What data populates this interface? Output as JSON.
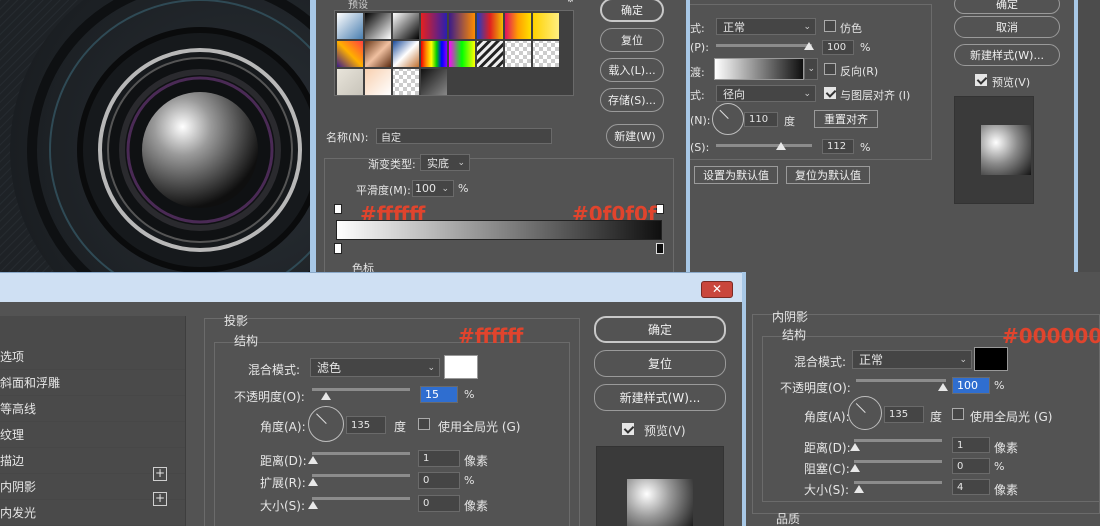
{
  "gradient_editor": {
    "title": "预设",
    "ok": "确定",
    "reset": "复位",
    "load": "载入(L)...",
    "save": "存储(S)...",
    "name_label": "名称(N):",
    "name_value": "自定",
    "new": "新建(W)",
    "type_label": "渐变类型:",
    "type_value": "实底",
    "smooth_label": "平滑度(M):",
    "smooth_value": "100",
    "smooth_unit": "%",
    "color_stops_label": "色标",
    "annotation_left": "#ffffff",
    "annotation_right": "#0f0f0f"
  },
  "gradient_overlay": {
    "mode_label": "式:",
    "mode_value": "正常",
    "dither": "仿色",
    "opacity_label": "(P):",
    "opacity_value": "100",
    "gradient_label": "渡:",
    "reverse": "反向(R)",
    "style_label": "式:",
    "style_value": "径向",
    "align": "与图层对齐 (I)",
    "angle_label": "(N):",
    "angle_value": "110",
    "angle_unit": "度",
    "reset_align": "重置对齐",
    "scale_label": "(S):",
    "scale_value": "112",
    "percent": "%",
    "set_default": "设置为默认值",
    "reset_default": "复位为默认值"
  },
  "top_right_dialog": {
    "ok": "确定",
    "cancel": "取消",
    "new_style": "新建样式(W)...",
    "preview": "预览(V)"
  },
  "drop_shadow": {
    "styles_list": [
      "选项",
      "斜面和浮雕",
      "等高线",
      "纹理",
      "描边",
      "内阴影",
      "内发光"
    ],
    "section_title": "投影",
    "structure": "结构",
    "blend_label": "混合模式:",
    "blend_value": "滤色",
    "opacity_label": "不透明度(O):",
    "opacity_value": "15",
    "percent": "%",
    "angle_label": "角度(A):",
    "angle_value": "135",
    "angle_unit": "度",
    "global_light": "使用全局光 (G)",
    "distance_label": "距离(D):",
    "distance_value": "1",
    "spread_label": "扩展(R):",
    "spread_value": "0",
    "size_label": "大小(S):",
    "size_value": "0",
    "px": "像素",
    "ok": "确定",
    "reset": "复位",
    "new_style": "新建样式(W)...",
    "preview": "预览(V)",
    "annotation": "#ffffff"
  },
  "inner_shadow": {
    "section_title": "内阴影",
    "structure": "结构",
    "blend_label": "混合模式:",
    "blend_value": "正常",
    "opacity_label": "不透明度(O):",
    "opacity_value": "100",
    "percent": "%",
    "angle_label": "角度(A):",
    "angle_value": "135",
    "angle_unit": "度",
    "global_light": "使用全局光 (G)",
    "distance_label": "距离(D):",
    "distance_value": "1",
    "choke_label": "阻塞(C):",
    "choke_value": "0",
    "size_label": "大小(S):",
    "size_value": "4",
    "px": "像素",
    "quality": "品质",
    "annotation": "#000000"
  },
  "colors": {
    "panel": "#535353",
    "annotation_red": "#e0442d",
    "title_bar": "#cfe0f3",
    "close_red": "#c9463c"
  }
}
